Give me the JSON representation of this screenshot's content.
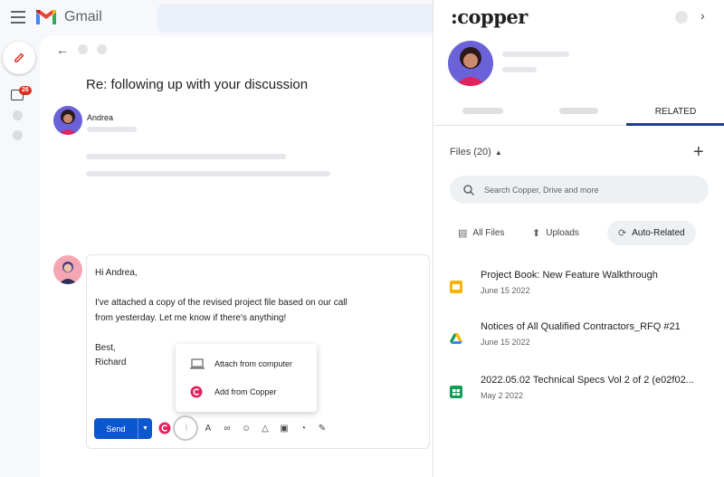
{
  "gmail": {
    "brand": "Gmail",
    "mail_badge_count": "26",
    "thread_subject": "Re: following up with your discussion",
    "sender_name": "Andrea",
    "reply_lines": [
      "Hi Andrea,",
      "I've attached a copy of the revised project file based on our call",
      "from yesterday. Let me know if there's anything!",
      "Best,",
      "Richard"
    ],
    "send_label": "Send",
    "attach_menu": [
      {
        "label": "Attach from computer",
        "icon": "laptop-icon"
      },
      {
        "label": "Add from Copper",
        "icon": "copper-logo-icon"
      }
    ]
  },
  "copper": {
    "brand": ":copper",
    "active_tab": "RELATED",
    "files_header": "Files (20)",
    "search_placeholder": "Search Copper, Drive and more",
    "filters": [
      {
        "label": "All Files",
        "icon": "files-stack-icon"
      },
      {
        "label": "Uploads",
        "icon": "upload-icon"
      },
      {
        "label": "Auto-Related",
        "icon": "sync-icon",
        "active": true
      }
    ],
    "files": [
      {
        "name": "Project Book: New Feature Walkthrough",
        "date": "June 15 2022",
        "icon": "google-slides-icon",
        "color": "#f4b400"
      },
      {
        "name": "Notices of All Qualified Contractors_RFQ #21",
        "date": "June 15 2022",
        "icon": "google-drive-icon",
        "color": "#4285f4"
      },
      {
        "name": "2022.05.02 Technical Specs Vol 2 of 2 (e02f02...",
        "date": "May 2 2022",
        "icon": "google-sheets-icon",
        "color": "#0f9d58"
      }
    ]
  },
  "colors": {
    "send_blue": "#0b57d0",
    "copper_red": "#e0245e",
    "tab_underline": "#233c8a",
    "avatar_purple": "#6b62d9",
    "badge_red": "#d93025"
  }
}
